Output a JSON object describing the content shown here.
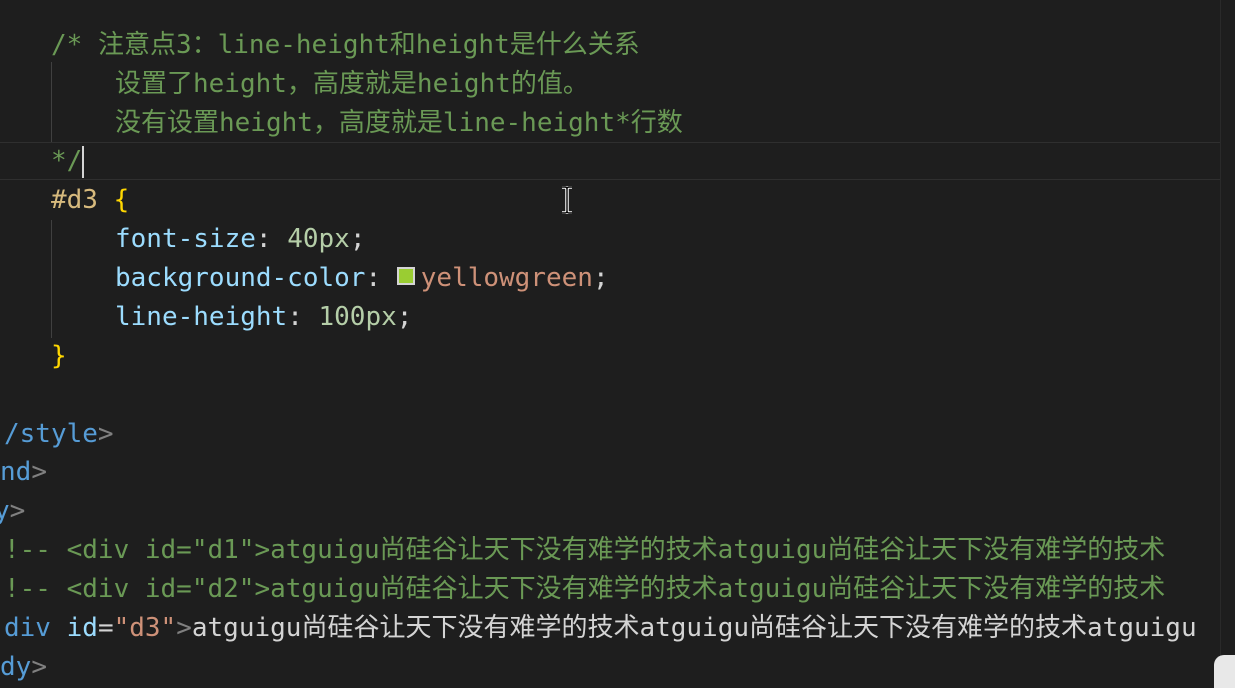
{
  "comment": {
    "open": "/* ",
    "line1_text": "注意点3：line-height和height是什么关系",
    "line2_text": "设置了height，高度就是height的值。",
    "line3_text": "没有设置height，高度就是line-height*行数",
    "close": "*/"
  },
  "css_rule": {
    "selector": "#d3",
    "open_brace": "{",
    "close_brace": "}",
    "declarations": [
      {
        "property": "font-size",
        "value": "40px",
        "type": "number"
      },
      {
        "property": "background-color",
        "value": "yellowgreen",
        "type": "color",
        "swatch_color": "#9acd32"
      },
      {
        "property": "line-height",
        "value": "100px",
        "type": "number"
      }
    ]
  },
  "html_lines": {
    "style_close": "/style",
    "head_close": "nd",
    "body_open": "y",
    "comment_line1": {
      "prefix": "!-- <div id=\"d1\">",
      "content": "atguigu尚硅谷让天下没有难学的技术atguigu尚硅谷让天下没有难学的技术"
    },
    "comment_line2": {
      "prefix": "!-- <div id=\"d2\">",
      "content": "atguigu尚硅谷让天下没有难学的技术atguigu尚硅谷让天下没有难学的技术"
    },
    "div_line": {
      "tag": "div",
      "attr": "id",
      "value": "\"d3\"",
      "content": "atguigu尚硅谷让天下没有难学的技术atguigu尚硅谷让天下没有难学的技术atguigu"
    },
    "body_close": "dy"
  },
  "colors": {
    "background": "#1e1e1e",
    "comment": "#6a9955",
    "selector": "#d7ba7d",
    "brace": "#ffd700",
    "property": "#9cdcfe",
    "number": "#b5cea8",
    "string": "#ce9178",
    "tag": "#569cd6"
  }
}
